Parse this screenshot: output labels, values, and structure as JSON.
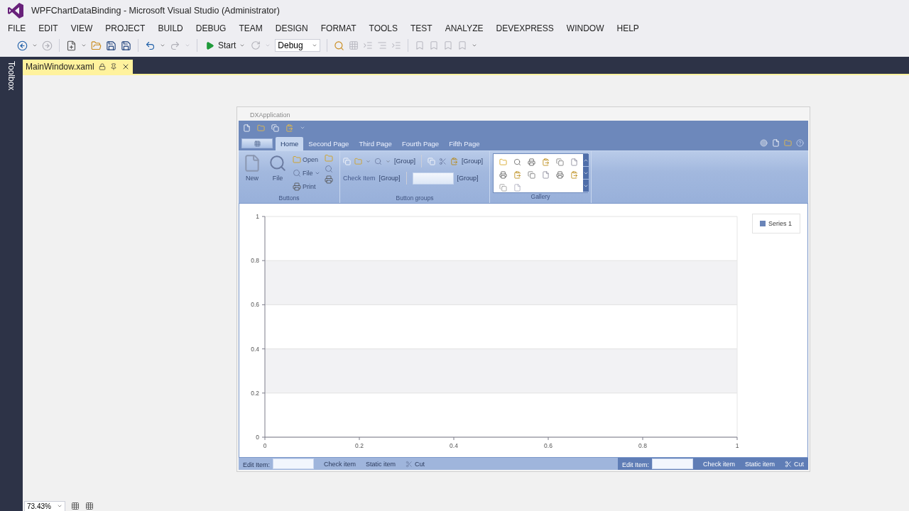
{
  "window": {
    "title": "WPFChartDataBinding - Microsoft Visual Studio (Administrator)"
  },
  "menu": [
    "FILE",
    "EDIT",
    "VIEW",
    "PROJECT",
    "BUILD",
    "DEBUG",
    "TEAM",
    "DESIGN",
    "FORMAT",
    "TOOLS",
    "TEST",
    "ANALYZE",
    "DEVEXPRESS",
    "WINDOW",
    "HELP"
  ],
  "toolbar": {
    "start": "Start",
    "configuration": "Debug"
  },
  "toolbox": {
    "label": "Toolbox"
  },
  "document_tabs": [
    {
      "label": "MainWindow.xaml",
      "selected": true
    }
  ],
  "designer": {
    "app_title": "DXApplication",
    "ribbon": {
      "tabs": [
        {
          "label": "Home",
          "selected": true
        },
        {
          "label": "Second Page",
          "selected": false
        },
        {
          "label": "Third Page",
          "selected": false
        },
        {
          "label": "Fourth Page",
          "selected": false
        },
        {
          "label": "Fifth Page",
          "selected": false
        }
      ],
      "groups": [
        {
          "kind": "buttons",
          "caption": "Buttons",
          "large": [
            "New",
            "File"
          ],
          "small": [
            "Open",
            "File",
            "Print"
          ]
        },
        {
          "kind": "button_groups",
          "caption": "Button groups",
          "group_labels": [
            "[Group]",
            "[Group]",
            "[Group]",
            "[Group]"
          ],
          "check_item": "Check Item"
        },
        {
          "kind": "gallery",
          "caption": "Gallery"
        }
      ]
    },
    "chart": {
      "chart_data": {
        "type": "line",
        "categories": [
          "0",
          "0.2",
          "0.4",
          "0.6",
          "0.8",
          "1"
        ],
        "ylim": [
          0,
          1
        ],
        "yticks": [
          0,
          0.2,
          0.4,
          0.6,
          0.8,
          1
        ],
        "grid": true,
        "series": [
          {
            "name": "Series 1",
            "color": "#6a84b8",
            "values": [
              null,
              null,
              null,
              null,
              null,
              null
            ]
          }
        ]
      }
    },
    "status_bar": {
      "left": [
        {
          "kind": "edit",
          "label": "Edit Item:"
        },
        {
          "kind": "check",
          "label": "Check item"
        },
        {
          "kind": "static",
          "label": "Static item"
        },
        {
          "kind": "button",
          "label": "Cut"
        }
      ],
      "right": [
        {
          "kind": "edit",
          "label": "Edit Item:"
        },
        {
          "kind": "check",
          "label": "Check item"
        },
        {
          "kind": "static",
          "label": "Static item"
        },
        {
          "kind": "button",
          "label": "Cut"
        }
      ]
    }
  },
  "zoom": {
    "value": "73.43%"
  }
}
